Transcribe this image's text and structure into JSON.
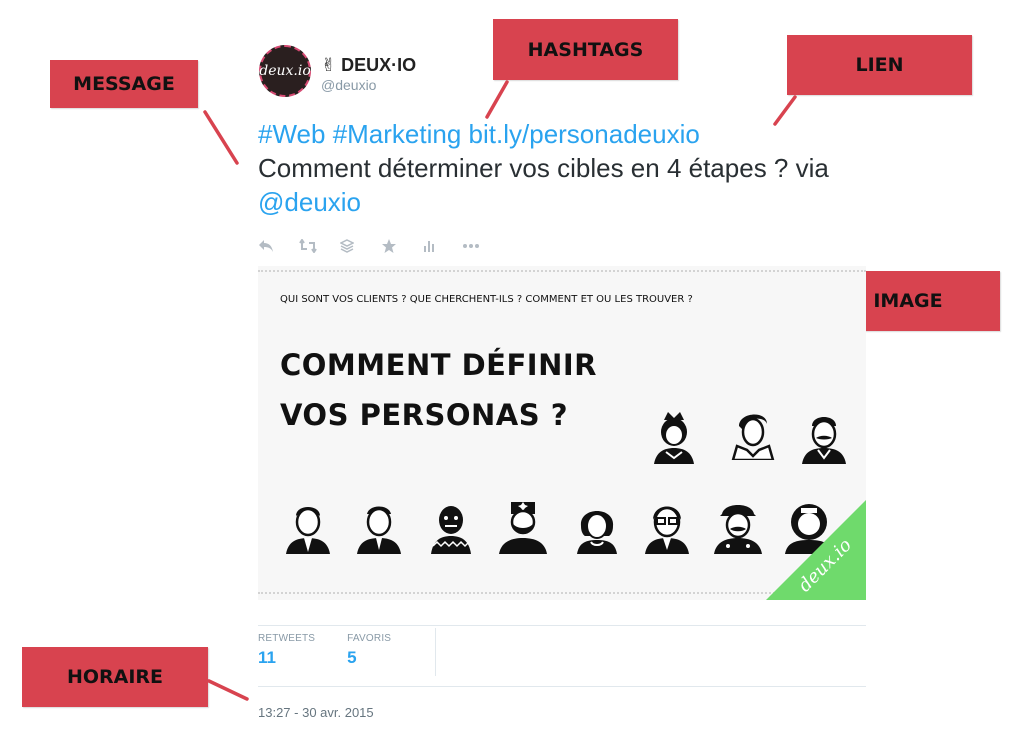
{
  "callouts": {
    "message": "MESSAGE",
    "hashtags": "HASHTAGS",
    "lien": "LIEN",
    "image": "IMAGE",
    "horaire": "HORAIRE"
  },
  "tweet": {
    "avatar_text": "deux.io",
    "display_name": "✌ DEUX·IO",
    "handle": "@deuxio",
    "hashtag1": "#Web",
    "hashtag2": "#Marketing",
    "link": "bit.ly/personadeuxio",
    "text_body": "Comment déterminer vos cibles en 4 étapes ? via",
    "mention": "@deuxio",
    "actions": {
      "reply": "reply-icon",
      "retweet": "retweet-icon",
      "buffer": "buffer-icon",
      "favorite": "star-icon",
      "analytics": "analytics-icon",
      "more": "more-icon"
    },
    "media": {
      "tagline": "QUI SONT VOS CLIENTS ? QUE CHERCHENT-ILS ? COMMENT ET OU LES TROUVER ?",
      "title_line1": "COMMENT DÉFINIR",
      "title_line2": "VOS PERSONAS ?",
      "badge": "deux.io"
    },
    "stats": {
      "retweets_label": "RETWEETS",
      "retweets_value": "11",
      "favoris_label": "FAVORIS",
      "favoris_value": "5"
    },
    "timestamp": "13:27 - 30 avr. 2015"
  },
  "colors": {
    "callout_bg": "#d8434f",
    "link": "#2aa3ef",
    "badge": "#6fda6c"
  }
}
